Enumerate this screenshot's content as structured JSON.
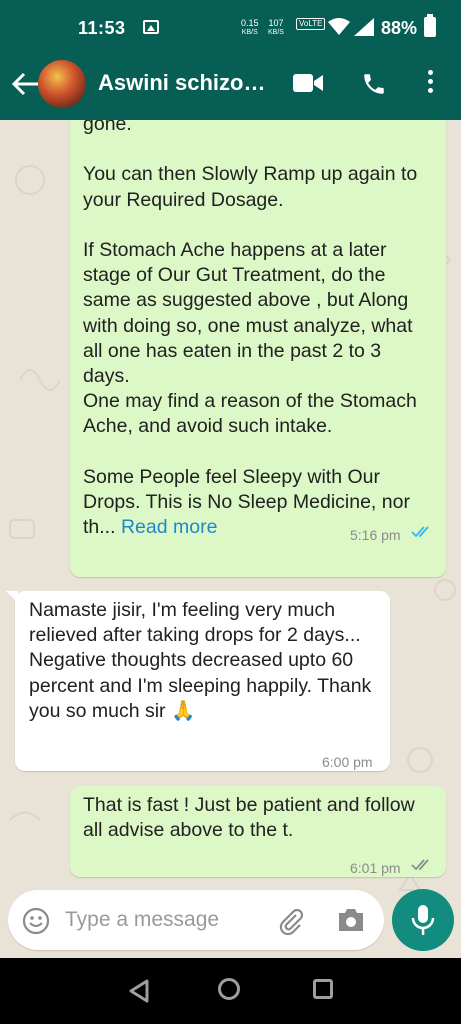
{
  "status_bar": {
    "time": "11:53",
    "net_speed_1": "0.15",
    "net_unit_1": "KB/S",
    "net_speed_2": "107",
    "net_unit_2": "KB/S",
    "volte": "VoLTE",
    "battery": "88%"
  },
  "app_bar": {
    "contact_name": "Aswini schizo…"
  },
  "messages": [
    {
      "direction": "outgoing",
      "text": "gone.\n\nYou can then Slowly Ramp up again to your Required Dosage.\n\nIf Stomach Ache happens at a later stage of Our Gut Treatment, do the same as suggested above , but Along with doing so, one must analyze, what all one has eaten in the past 2 to 3 days.\nOne may find a reason of the Stomach Ache, and avoid such intake.\n\nSome People feel Sleepy with Our Drops. This is No Sleep Medicine, nor th...",
      "read_more": "Read more",
      "time": "5:16 pm",
      "status": "read"
    },
    {
      "direction": "incoming",
      "text": "Namaste jisir, I'm feeling very much relieved after taking drops for 2 days... Negative thoughts decreased upto 60 percent and I'm sleeping happily. Thank you so much sir 🙏",
      "time": "6:00 pm"
    },
    {
      "direction": "outgoing",
      "text": "That is fast ! Just be patient and follow all advise above to the t.",
      "time": "6:01 pm",
      "status": "delivered"
    }
  ],
  "composer": {
    "placeholder": "Type a message"
  },
  "icons": [
    "back-arrow-icon",
    "video-call-icon",
    "phone-icon",
    "more-icon",
    "emoji-icon",
    "attach-icon",
    "camera-icon",
    "mic-icon",
    "nav-back-icon",
    "nav-home-icon",
    "nav-recents-icon"
  ],
  "colors": {
    "header": "#075e54",
    "outgoing_bubble": "#dcf8c6",
    "incoming_bubble": "#ffffff",
    "mic_button": "#128c7e",
    "read_ticks": "#34b7f1"
  }
}
